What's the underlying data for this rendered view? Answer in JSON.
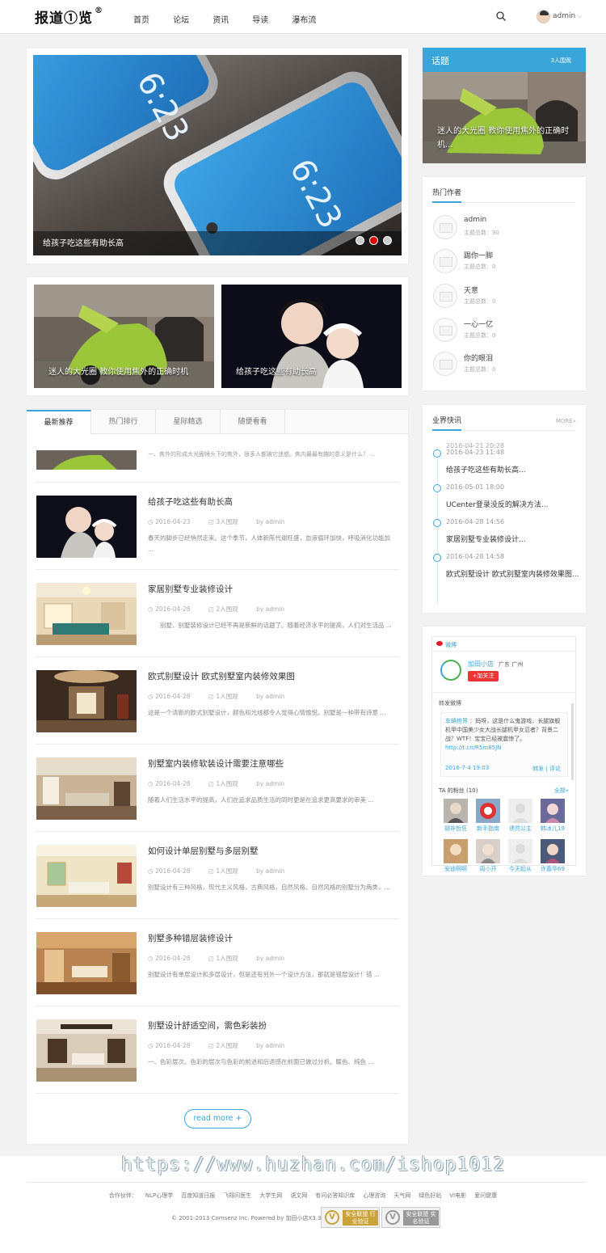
{
  "header": {
    "logo": "报道①览",
    "logo_mark": "®",
    "nav": [
      "首页",
      "论坛",
      "资讯",
      "导读",
      "瀑布流"
    ],
    "username": "admin",
    "caret": "⌵"
  },
  "slider": {
    "caption": "给孩子吃这些有助长高",
    "active_dot": 1,
    "dot_count": 3
  },
  "dual": [
    {
      "title": "迷人的大光圈 教你使用焦外的正确时机"
    },
    {
      "title": "给孩子吃这些有助长高"
    }
  ],
  "feed": {
    "tabs": [
      "最新推荐",
      "热门排行",
      "星际精选",
      "随便看看"
    ],
    "first_snippet": "一、焦外的形成大光圈镜头下的焦外，很多人都被它迷惑。焦内最最有趣的意义是什么？ ...",
    "articles": [
      {
        "title": "给孩子吃这些有助长高",
        "date": "2016-04-23",
        "views": "3人围观",
        "author": "by admin",
        "desc": "春天的脚步已经悄然走来。这个季节，人体新陈代谢旺盛，血液循环加快，呼吸消化功能加 ..."
      },
      {
        "title": "家居别墅专业装修设计",
        "date": "2016-04-28",
        "views": "2人围观",
        "author": "by admin",
        "desc": "　　别墅、别墅装修设计已经不再是新鲜的话题了。随着经济水平的提高，人们对生活品 ..."
      },
      {
        "title": "欧式别墅设计 欧式别墅室内装修效果图",
        "date": "2016-04-28",
        "views": "1人围观",
        "author": "by admin",
        "desc": "这是一个清新的欧式别墅设计，颜色和光线都令人觉得心情愉悦。别墅是一种带有诗意 ..."
      },
      {
        "title": "别墅室内装修软装设计需要注意哪些",
        "date": "2016-04-28",
        "views": "1人围观",
        "author": "by admin",
        "desc": "随着人们生活水平的提高，人们在追求品质生活的同时更是在追求更高要求的审美 ..."
      },
      {
        "title": "如何设计单层别墅与多层别墅",
        "date": "2016-04-28",
        "views": "1人围观",
        "author": "by admin",
        "desc": "别墅设计有三种风格，现代主义风格，古典风格，自然风格。自然风格的别墅分为两类，..."
      },
      {
        "title": "别墅多种错层装修设计",
        "date": "2016-04-28",
        "views": "1人围观",
        "author": "by admin",
        "desc": "别墅设计有单层设计和多层设计，但是还有另外一个设计方法，那就是错层设计！错 ..."
      },
      {
        "title": "别墅设计舒适空间，需色彩装扮",
        "date": "2016-04-28",
        "views": "2人围观",
        "author": "by admin",
        "desc": "一、色彩层次。色彩的层次与色彩的前进和后退感在前面已做过分析。暖色、纯色 ..."
      }
    ],
    "read_more": "read more +"
  },
  "topic": {
    "title": "话题",
    "count": "3人围观",
    "caption": "迷人的大光圈 教你使用焦外的正确时机..."
  },
  "authors": {
    "title": "热门作者",
    "items": [
      {
        "name": "admin",
        "count": "主题总数：90"
      },
      {
        "name": "踢你一脚",
        "count": "主题总数：0"
      },
      {
        "name": "天意",
        "count": "主题总数：0"
      },
      {
        "name": "一心一亿",
        "count": "主题总数：0"
      },
      {
        "name": "你的眼泪",
        "count": "主题总数：0"
      }
    ]
  },
  "news": {
    "title": "业界快讯",
    "more": "MORE»",
    "overlap_date": "2016-04-21 20:28",
    "items": [
      {
        "date": "2016-04-23 11:48",
        "title": "给孩子吃这些有助长高..."
      },
      {
        "date": "2016-05-01 18:00",
        "title": "UCenter登录没反的解决方法..."
      },
      {
        "date": "2016-04-28 14:56",
        "title": "家居别墅专业装修设计..."
      },
      {
        "date": "2016-04-28 14:58",
        "title": "欧式别墅设计 欧式别墅室内装修效果图..."
      }
    ]
  },
  "weibo": {
    "label": "微博",
    "name": "加田小店",
    "location": "广东 广州",
    "follow": "+加关注",
    "forward_label": "转发微博",
    "post_author": "车辆世界",
    "post_text": "：妈呀，这是什么鬼游戏，长腿旗舰机甲中国美少女大战长腿机甲女忍者？背景二战？WTF！宝宝已经被震惊了。",
    "post_link": "http://t.cn/R5m85JN",
    "post_time": "2016-7-4 19:03",
    "post_actions": "转发 | 评论",
    "fans_label": "TA 的粉丝 (10)",
    "fans_all": "全部»",
    "fans": [
      "胡非哲狂",
      "新手指南",
      "诱然公主",
      "韩冰儿19",
      "安迪啊啊",
      "周小开",
      "今天起从",
      "许嘉华69"
    ]
  },
  "footer": {
    "partners": [
      "合作伙伴：",
      "NLP心理学",
      "百度知道日报",
      "飞翔问医生",
      "大学生网",
      "语文网",
      "有问必答知识库",
      "心理咨询",
      "天气网",
      "绿色好贴",
      "VI电影",
      "爱问健康"
    ],
    "copyright": "© 2001-2013 Comsenz Inc. Powered by 加田小店X3.3",
    "badges": [
      {
        "text": "安全联盟 行业验证"
      },
      {
        "text": "安全联盟 实名验证"
      }
    ]
  },
  "watermark": "https://www.huzhan.com/ishop1012",
  "colors": {
    "accent": "#38a6d8",
    "follow": "#e33333",
    "active_dot": "#dd0000"
  }
}
